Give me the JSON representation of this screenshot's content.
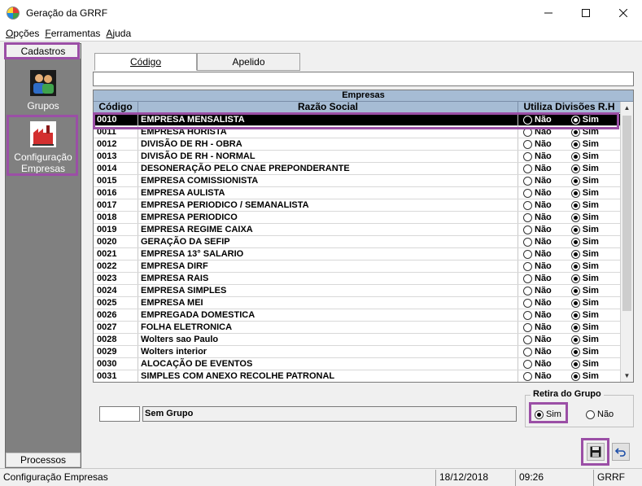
{
  "window": {
    "title": "Geração da GRRF"
  },
  "menu": [
    "Opções",
    "Ferramentas",
    "Ajuda"
  ],
  "left_panel": {
    "header": "Cadastros",
    "items": [
      {
        "label": "Grupos",
        "icon": "users-group-icon"
      },
      {
        "label": "Configuração\nEmpresas",
        "label_line1": "Configuração",
        "label_line2": "Empresas",
        "icon": "factory-icon"
      }
    ],
    "footer": "Processos"
  },
  "tabs": [
    "Código",
    "Apelido"
  ],
  "grid": {
    "title": "Empresas",
    "columns": [
      "Código",
      "Razão Social",
      "Utiliza Divisões R.H"
    ],
    "option_labels": {
      "no": "Não",
      "yes": "Sim"
    },
    "rows": [
      {
        "code": "0010",
        "name": "EMPRESA MENSALISTA",
        "utiliza": "Sim",
        "selected": true
      },
      {
        "code": "0011",
        "name": "EMPRESA HORISTA",
        "utiliza": "Sim"
      },
      {
        "code": "0012",
        "name": "DIVISÃO DE RH - OBRA",
        "utiliza": "Sim"
      },
      {
        "code": "0013",
        "name": "DIVISÃO DE RH - NORMAL",
        "utiliza": "Sim"
      },
      {
        "code": "0014",
        "name": "DESONERAÇÃO PELO CNAE PREPONDERANTE",
        "utiliza": "Sim"
      },
      {
        "code": "0015",
        "name": "EMPRESA COMISSIONISTA",
        "utiliza": "Sim"
      },
      {
        "code": "0016",
        "name": "EMPRESA AULISTA",
        "utiliza": "Sim"
      },
      {
        "code": "0017",
        "name": "EMPRESA PERIODICO / SEMANALISTA",
        "utiliza": "Sim"
      },
      {
        "code": "0018",
        "name": "EMPRESA PERIODICO",
        "utiliza": "Sim"
      },
      {
        "code": "0019",
        "name": "EMPRESA REGIME CAIXA",
        "utiliza": "Sim"
      },
      {
        "code": "0020",
        "name": "GERAÇÃO DA SEFIP",
        "utiliza": "Sim"
      },
      {
        "code": "0021",
        "name": "EMPRESA 13° SALARIO",
        "utiliza": "Sim"
      },
      {
        "code": "0022",
        "name": "EMPRESA DIRF",
        "utiliza": "Sim"
      },
      {
        "code": "0023",
        "name": "EMPRESA RAIS",
        "utiliza": "Sim"
      },
      {
        "code": "0024",
        "name": "EMPRESA SIMPLES",
        "utiliza": "Sim"
      },
      {
        "code": "0025",
        "name": "EMPRESA MEI",
        "utiliza": "Sim"
      },
      {
        "code": "0026",
        "name": "EMPREGADA DOMESTICA",
        "utiliza": "Sim"
      },
      {
        "code": "0027",
        "name": "FOLHA ELETRONICA",
        "utiliza": "Sim"
      },
      {
        "code": "0028",
        "name": "Wolters sao Paulo",
        "utiliza": "Sim"
      },
      {
        "code": "0029",
        "name": "Wolters interior",
        "utiliza": "Sim"
      },
      {
        "code": "0030",
        "name": "ALOCAÇÃO DE EVENTOS",
        "utiliza": "Sim"
      },
      {
        "code": "0031",
        "name": "SIMPLES COM ANEXO RECOLHE PATRONAL",
        "utiliza": "Sim"
      }
    ]
  },
  "group": {
    "code": "",
    "name": "Sem Grupo"
  },
  "retira_grupo": {
    "legend": "Retira do Grupo",
    "options": [
      "Sim",
      "Não"
    ],
    "selected": "Sim"
  },
  "status": {
    "message": "Configuração Empresas",
    "date": "18/12/2018",
    "time": "09:26",
    "module": "GRRF"
  },
  "colors": {
    "highlight": "#9b4fa6",
    "grid_header": "#a6bcd4",
    "selected_row": "#000000"
  }
}
